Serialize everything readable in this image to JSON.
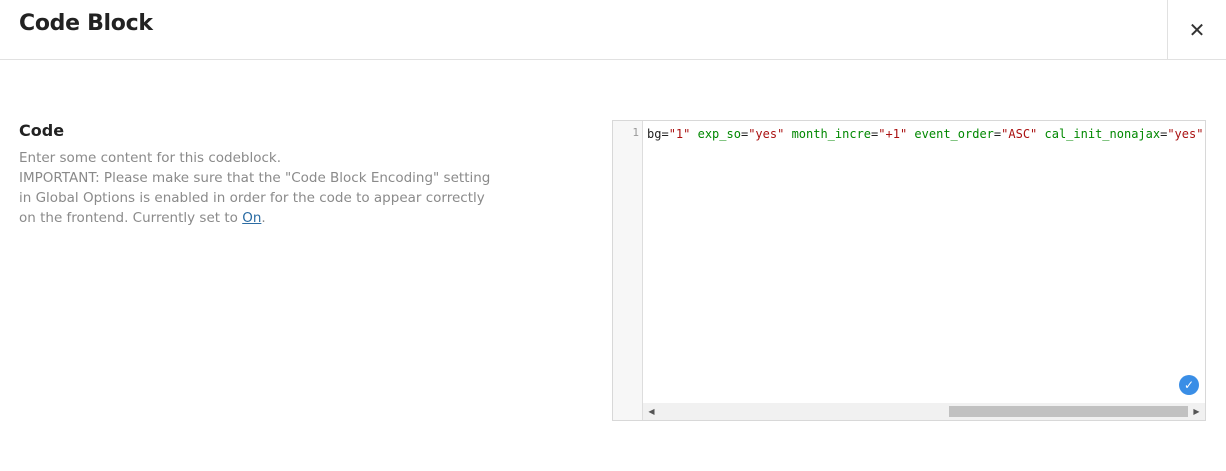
{
  "modal": {
    "title": "Code Block",
    "close_icon": "close-icon",
    "close_symbol": "✕"
  },
  "field": {
    "label": "Code",
    "description_line1": "Enter some content for this codeblock.",
    "description_line2": "IMPORTANT: Please make sure that the \"Code Block Encoding\" setting in Global Options is enabled in order for the code to appear correctly on the frontend. Currently set to",
    "setting_link": "On",
    "description_end": "."
  },
  "editor": {
    "line_number": "1",
    "tokens": [
      {
        "type": "plain",
        "text": "bg="
      },
      {
        "type": "str",
        "text": "\"1\""
      },
      {
        "type": "plain",
        "text": " "
      },
      {
        "type": "attr",
        "text": "exp_so"
      },
      {
        "type": "plain",
        "text": "="
      },
      {
        "type": "str",
        "text": "\"yes\""
      },
      {
        "type": "plain",
        "text": " "
      },
      {
        "type": "attr",
        "text": "month_incre"
      },
      {
        "type": "plain",
        "text": "="
      },
      {
        "type": "str",
        "text": "\"+1\""
      },
      {
        "type": "plain",
        "text": " "
      },
      {
        "type": "attr",
        "text": "event_order"
      },
      {
        "type": "plain",
        "text": "="
      },
      {
        "type": "str",
        "text": "\"ASC\""
      },
      {
        "type": "plain",
        "text": " "
      },
      {
        "type": "attr",
        "text": "cal_init_nonajax"
      },
      {
        "type": "plain",
        "text": "="
      },
      {
        "type": "str",
        "text": "\"yes\""
      },
      {
        "type": "plain",
        "text": "]"
      }
    ],
    "valid_icon": "check-circle-icon",
    "valid_symbol": "✓",
    "scroll_left_icon": "arrow-left-icon",
    "scroll_left_symbol": "◀",
    "scroll_right_icon": "arrow-right-icon",
    "scroll_right_symbol": "▶"
  },
  "colors": {
    "attr": "#008800",
    "string": "#aa1111",
    "link": "#2b6ca3",
    "badge": "#3a8ee6"
  }
}
